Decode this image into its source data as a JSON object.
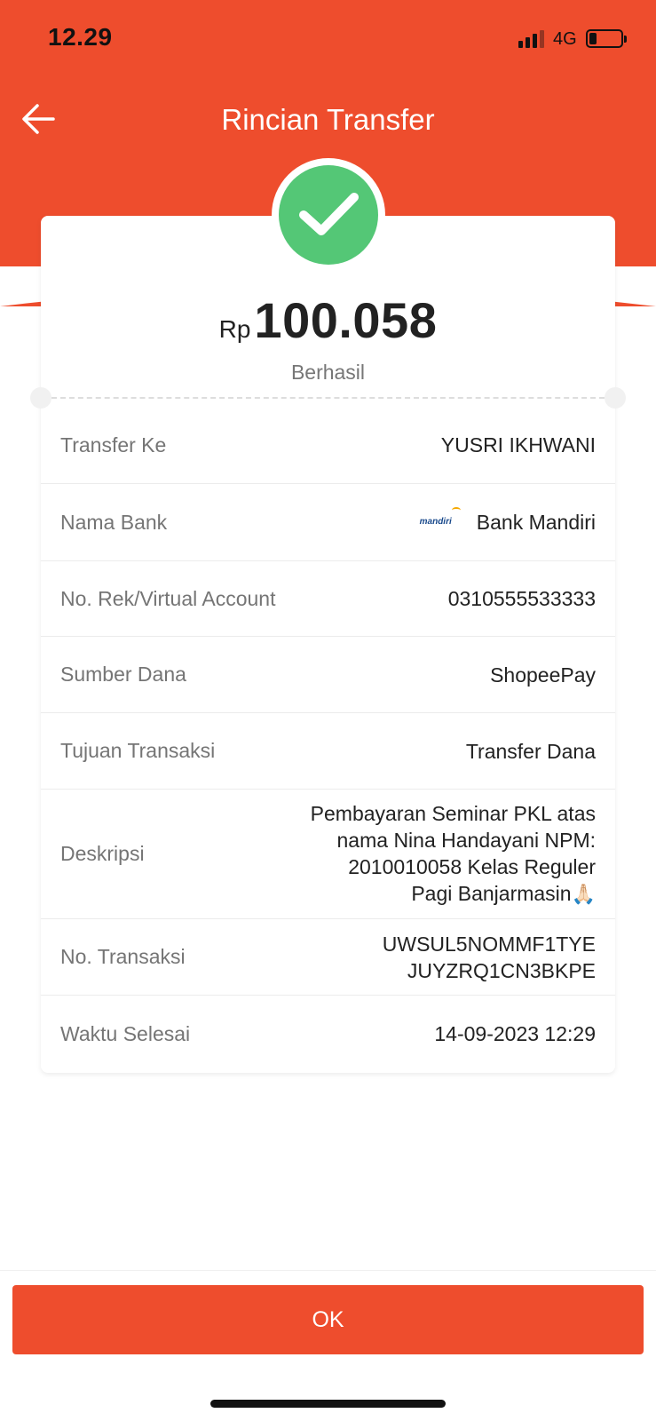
{
  "status_bar": {
    "time": "12.29",
    "network": "4G"
  },
  "header": {
    "title": "Rincian Transfer"
  },
  "summary": {
    "currency": "Rp",
    "amount": "100.058",
    "status": "Berhasil"
  },
  "details": {
    "transfer_ke": {
      "label": "Transfer Ke",
      "value": "YUSRI IKHWANI"
    },
    "nama_bank": {
      "label": "Nama Bank",
      "value": "Bank Mandiri",
      "logo_text": "mandiri"
    },
    "no_rek": {
      "label": "No. Rek/Virtual Account",
      "value": "0310555533333"
    },
    "sumber_dana": {
      "label": "Sumber Dana",
      "value": "ShopeePay"
    },
    "tujuan": {
      "label": "Tujuan Transaksi",
      "value": "Transfer Dana"
    },
    "deskripsi": {
      "label": "Deskripsi",
      "lines": [
        "Pembayaran Seminar PKL atas",
        "nama Nina Handayani NPM:",
        "2010010058 Kelas Reguler",
        "Pagi Banjarmasin"
      ],
      "emoji": "🙏🏻"
    },
    "no_transaksi": {
      "label": "No. Transaksi",
      "lines": [
        "UWSUL5NOMMF1TYE",
        "JUYZRQ1CN3BKPE"
      ]
    },
    "waktu": {
      "label": "Waktu Selesai",
      "value": "14-09-2023 12:29"
    }
  },
  "footer": {
    "ok_label": "OK"
  },
  "icons": {
    "back": "arrow-left-icon",
    "success": "checkmark-icon",
    "signal": "signal-icon",
    "battery": "battery-icon"
  },
  "colors": {
    "brand": "#ee4d2d",
    "success": "#54c776",
    "label_gray": "#757575",
    "text_dark": "#222222"
  }
}
